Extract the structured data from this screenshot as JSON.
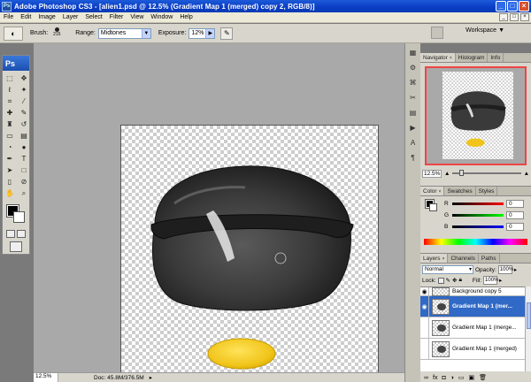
{
  "window": {
    "app_icon": "Ps",
    "title": "Adobe Photoshop CS3 - [alien1.psd @ 12.5% (Gradient Map 1 (merged) copy 2, RGB/8)]",
    "controls": [
      "_",
      "□",
      "×"
    ]
  },
  "menu": {
    "items": [
      "File",
      "Edit",
      "Image",
      "Layer",
      "Select",
      "Filter",
      "View",
      "Window",
      "Help"
    ],
    "doc_controls": [
      "_",
      "□",
      "×"
    ]
  },
  "options": {
    "brush_label": "Brush:",
    "brush_size": "215",
    "range_label": "Range:",
    "range_value": "Midtones",
    "exposure_label": "Exposure:",
    "exposure_value": "12%",
    "workspace_label": "Workspace"
  },
  "toolbox": {
    "logo": "Ps",
    "foreground_color": "#000000",
    "background_color": "#ffffff"
  },
  "canvas": {
    "object_color": "#3a3a3a",
    "disc_color": "#f0c419"
  },
  "status": {
    "zoom": "12.5%",
    "doc": "Doc: 45.8M/376.5M"
  },
  "navigator": {
    "tabs": [
      "Navigator",
      "Histogram",
      "Info"
    ],
    "zoom": "12.5%"
  },
  "color_panel": {
    "tabs": [
      "Color",
      "Swatches",
      "Styles"
    ],
    "channels": [
      {
        "label": "R",
        "value": "0",
        "color": "#d11"
      },
      {
        "label": "G",
        "value": "0",
        "color": "#1a1"
      },
      {
        "label": "B",
        "value": "0",
        "color": "#11d"
      }
    ]
  },
  "layers_panel": {
    "tabs": [
      "Layers",
      "Channels",
      "Paths"
    ],
    "blend_mode": "Normal",
    "opacity_label": "Opacity:",
    "opacity_value": "100%",
    "lock_label": "Lock:",
    "fill_label": "Fill:",
    "fill_value": "100%",
    "layers": [
      {
        "name": "Background copy 5",
        "visible": true,
        "selected": false
      },
      {
        "name": "Gradient Map 1 (mer...",
        "visible": true,
        "selected": true
      },
      {
        "name": "Gradient Map 1 (merge...",
        "visible": false,
        "selected": false
      },
      {
        "name": "Gradient Map 1 (merged)",
        "visible": false,
        "selected": false
      }
    ]
  }
}
